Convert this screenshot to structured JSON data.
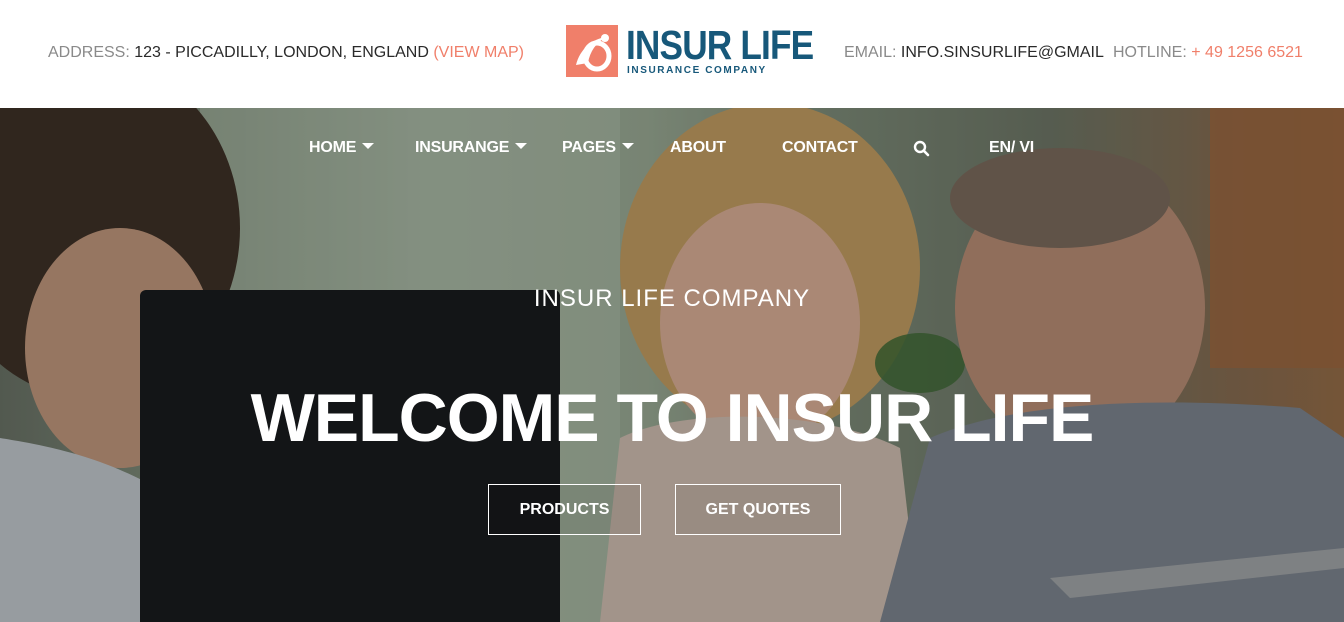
{
  "topbar": {
    "address_label": "ADDRESS:",
    "address_value": "123 - PICCADILLY, LONDON, ENGLAND",
    "address_link": "(VIEW MAP)",
    "email_label": "EMAIL:",
    "email_value": "INFO.SINSURLIFE@GMAIL",
    "hotline_label": "HOTLINE:",
    "hotline_value": "+ 49 1256 6521"
  },
  "logo": {
    "name": "INSUR LIFE",
    "tagline": "INSURANCE COMPANY",
    "icon": "insur-life-logo-mark"
  },
  "nav": {
    "items": [
      {
        "label": "HOME",
        "dropdown": true
      },
      {
        "label": "INSURANGE",
        "dropdown": true
      },
      {
        "label": "PAGES",
        "dropdown": true
      },
      {
        "label": "ABOUT",
        "dropdown": false
      },
      {
        "label": "CONTACT",
        "dropdown": false
      }
    ],
    "search_icon": "search-icon",
    "language": "EN/ VI"
  },
  "hero": {
    "subtitle": "INSUR LIFE COMPANY",
    "title": "WELCOME TO INSUR LIFE",
    "buttons": {
      "products": "PRODUCTS",
      "quotes": "GET QUOTES"
    }
  },
  "colors": {
    "accent": "#f07f6a",
    "brand": "#17587a",
    "text_dark": "#2a2a2a",
    "text_muted": "#8a8a8a"
  }
}
